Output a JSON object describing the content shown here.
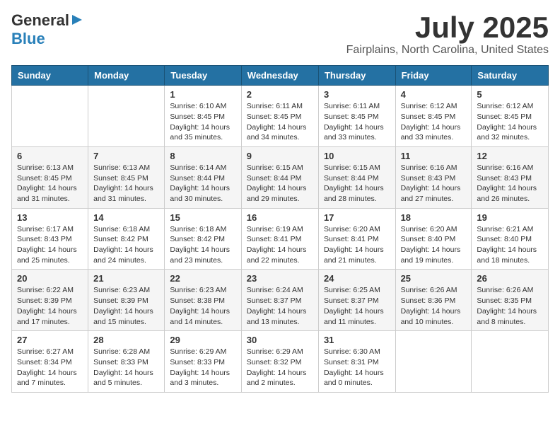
{
  "logo": {
    "top": "General",
    "arrow": "▶",
    "bottom": "Blue"
  },
  "title": "July 2025",
  "location": "Fairplains, North Carolina, United States",
  "days_of_week": [
    "Sunday",
    "Monday",
    "Tuesday",
    "Wednesday",
    "Thursday",
    "Friday",
    "Saturday"
  ],
  "weeks": [
    [
      {
        "day": "",
        "info": ""
      },
      {
        "day": "",
        "info": ""
      },
      {
        "day": "1",
        "info": "Sunrise: 6:10 AM\nSunset: 8:45 PM\nDaylight: 14 hours and 35 minutes."
      },
      {
        "day": "2",
        "info": "Sunrise: 6:11 AM\nSunset: 8:45 PM\nDaylight: 14 hours and 34 minutes."
      },
      {
        "day": "3",
        "info": "Sunrise: 6:11 AM\nSunset: 8:45 PM\nDaylight: 14 hours and 33 minutes."
      },
      {
        "day": "4",
        "info": "Sunrise: 6:12 AM\nSunset: 8:45 PM\nDaylight: 14 hours and 33 minutes."
      },
      {
        "day": "5",
        "info": "Sunrise: 6:12 AM\nSunset: 8:45 PM\nDaylight: 14 hours and 32 minutes."
      }
    ],
    [
      {
        "day": "6",
        "info": "Sunrise: 6:13 AM\nSunset: 8:45 PM\nDaylight: 14 hours and 31 minutes."
      },
      {
        "day": "7",
        "info": "Sunrise: 6:13 AM\nSunset: 8:45 PM\nDaylight: 14 hours and 31 minutes."
      },
      {
        "day": "8",
        "info": "Sunrise: 6:14 AM\nSunset: 8:44 PM\nDaylight: 14 hours and 30 minutes."
      },
      {
        "day": "9",
        "info": "Sunrise: 6:15 AM\nSunset: 8:44 PM\nDaylight: 14 hours and 29 minutes."
      },
      {
        "day": "10",
        "info": "Sunrise: 6:15 AM\nSunset: 8:44 PM\nDaylight: 14 hours and 28 minutes."
      },
      {
        "day": "11",
        "info": "Sunrise: 6:16 AM\nSunset: 8:43 PM\nDaylight: 14 hours and 27 minutes."
      },
      {
        "day": "12",
        "info": "Sunrise: 6:16 AM\nSunset: 8:43 PM\nDaylight: 14 hours and 26 minutes."
      }
    ],
    [
      {
        "day": "13",
        "info": "Sunrise: 6:17 AM\nSunset: 8:43 PM\nDaylight: 14 hours and 25 minutes."
      },
      {
        "day": "14",
        "info": "Sunrise: 6:18 AM\nSunset: 8:42 PM\nDaylight: 14 hours and 24 minutes."
      },
      {
        "day": "15",
        "info": "Sunrise: 6:18 AM\nSunset: 8:42 PM\nDaylight: 14 hours and 23 minutes."
      },
      {
        "day": "16",
        "info": "Sunrise: 6:19 AM\nSunset: 8:41 PM\nDaylight: 14 hours and 22 minutes."
      },
      {
        "day": "17",
        "info": "Sunrise: 6:20 AM\nSunset: 8:41 PM\nDaylight: 14 hours and 21 minutes."
      },
      {
        "day": "18",
        "info": "Sunrise: 6:20 AM\nSunset: 8:40 PM\nDaylight: 14 hours and 19 minutes."
      },
      {
        "day": "19",
        "info": "Sunrise: 6:21 AM\nSunset: 8:40 PM\nDaylight: 14 hours and 18 minutes."
      }
    ],
    [
      {
        "day": "20",
        "info": "Sunrise: 6:22 AM\nSunset: 8:39 PM\nDaylight: 14 hours and 17 minutes."
      },
      {
        "day": "21",
        "info": "Sunrise: 6:23 AM\nSunset: 8:39 PM\nDaylight: 14 hours and 15 minutes."
      },
      {
        "day": "22",
        "info": "Sunrise: 6:23 AM\nSunset: 8:38 PM\nDaylight: 14 hours and 14 minutes."
      },
      {
        "day": "23",
        "info": "Sunrise: 6:24 AM\nSunset: 8:37 PM\nDaylight: 14 hours and 13 minutes."
      },
      {
        "day": "24",
        "info": "Sunrise: 6:25 AM\nSunset: 8:37 PM\nDaylight: 14 hours and 11 minutes."
      },
      {
        "day": "25",
        "info": "Sunrise: 6:26 AM\nSunset: 8:36 PM\nDaylight: 14 hours and 10 minutes."
      },
      {
        "day": "26",
        "info": "Sunrise: 6:26 AM\nSunset: 8:35 PM\nDaylight: 14 hours and 8 minutes."
      }
    ],
    [
      {
        "day": "27",
        "info": "Sunrise: 6:27 AM\nSunset: 8:34 PM\nDaylight: 14 hours and 7 minutes."
      },
      {
        "day": "28",
        "info": "Sunrise: 6:28 AM\nSunset: 8:33 PM\nDaylight: 14 hours and 5 minutes."
      },
      {
        "day": "29",
        "info": "Sunrise: 6:29 AM\nSunset: 8:33 PM\nDaylight: 14 hours and 3 minutes."
      },
      {
        "day": "30",
        "info": "Sunrise: 6:29 AM\nSunset: 8:32 PM\nDaylight: 14 hours and 2 minutes."
      },
      {
        "day": "31",
        "info": "Sunrise: 6:30 AM\nSunset: 8:31 PM\nDaylight: 14 hours and 0 minutes."
      },
      {
        "day": "",
        "info": ""
      },
      {
        "day": "",
        "info": ""
      }
    ]
  ]
}
